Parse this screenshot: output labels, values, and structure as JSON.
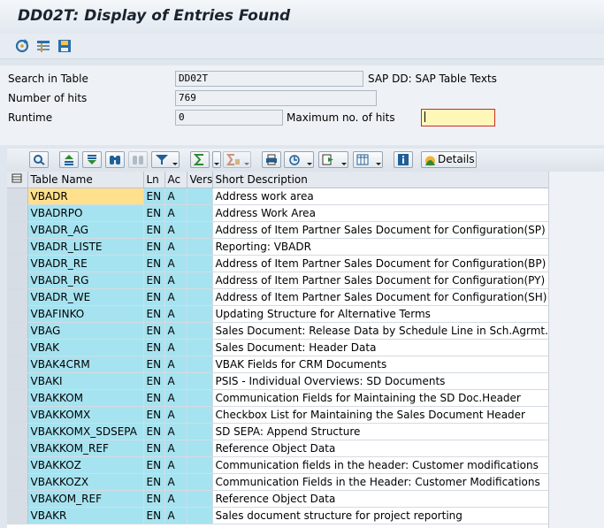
{
  "window": {
    "title": "DD02T: Display of Entries Found"
  },
  "toolbar": {
    "icons": [
      "refresh-icon",
      "select-table-icon",
      "save-icon"
    ]
  },
  "form": {
    "search_label": "Search in Table",
    "search_value": "DD02T",
    "search_desc": "SAP DD: SAP Table Texts",
    "hits_label": "Number of hits",
    "hits_value": "769",
    "runtime_label": "Runtime",
    "runtime_value": "0",
    "maxhits_label": "Maximum no. of hits",
    "maxhits_value": ""
  },
  "grid_toolbar": {
    "details_label": "Details"
  },
  "columns": [
    "Table Name",
    "Ln",
    "Ac",
    "Vers",
    "Short Description"
  ],
  "rows": [
    [
      "VBADR",
      "EN",
      "A",
      "",
      "Address work area"
    ],
    [
      "VBADRPO",
      "EN",
      "A",
      "",
      "Address Work Area"
    ],
    [
      "VBADR_AG",
      "EN",
      "A",
      "",
      "Address of Item Partner Sales Document for Configuration(SP)"
    ],
    [
      "VBADR_LISTE",
      "EN",
      "A",
      "",
      "Reporting: VBADR"
    ],
    [
      "VBADR_RE",
      "EN",
      "A",
      "",
      "Address of Item Partner Sales Document for Configuration(BP)"
    ],
    [
      "VBADR_RG",
      "EN",
      "A",
      "",
      "Address of Item Partner Sales Document for Configuration(PY)"
    ],
    [
      "VBADR_WE",
      "EN",
      "A",
      "",
      "Address of Item Partner Sales Document for Configuration(SH)"
    ],
    [
      "VBAFINKO",
      "EN",
      "A",
      "",
      "Updating Structure for Alternative Terms"
    ],
    [
      "VBAG",
      "EN",
      "A",
      "",
      "Sales Document: Release Data by Schedule Line in Sch.Agrmt."
    ],
    [
      "VBAK",
      "EN",
      "A",
      "",
      "Sales Document: Header Data"
    ],
    [
      "VBAK4CRM",
      "EN",
      "A",
      "",
      "VBAK Fields for CRM Documents"
    ],
    [
      "VBAKI",
      "EN",
      "A",
      "",
      "PSIS - Individual Overviews: SD Documents"
    ],
    [
      "VBAKKOM",
      "EN",
      "A",
      "",
      "Communication Fields for Maintaining the SD Doc.Header"
    ],
    [
      "VBAKKOMX",
      "EN",
      "A",
      "",
      "Checkbox List for Maintaining the Sales Document Header"
    ],
    [
      "VBAKKOMX_SDSEPA",
      "EN",
      "A",
      "",
      "SD SEPA: Append Structure"
    ],
    [
      "VBAKKOM_REF",
      "EN",
      "A",
      "",
      "Reference Object Data"
    ],
    [
      "VBAKKOZ",
      "EN",
      "A",
      "",
      "Communication fields in the header: Customer modifications"
    ],
    [
      "VBAKKOZX",
      "EN",
      "A",
      "",
      "Communication Fields in the Header: Customer Modifications"
    ],
    [
      "VBAKOM_REF",
      "EN",
      "A",
      "",
      "Reference Object Data"
    ],
    [
      "VBAKR",
      "EN",
      "A",
      "",
      "Sales document structure for project reporting"
    ]
  ]
}
